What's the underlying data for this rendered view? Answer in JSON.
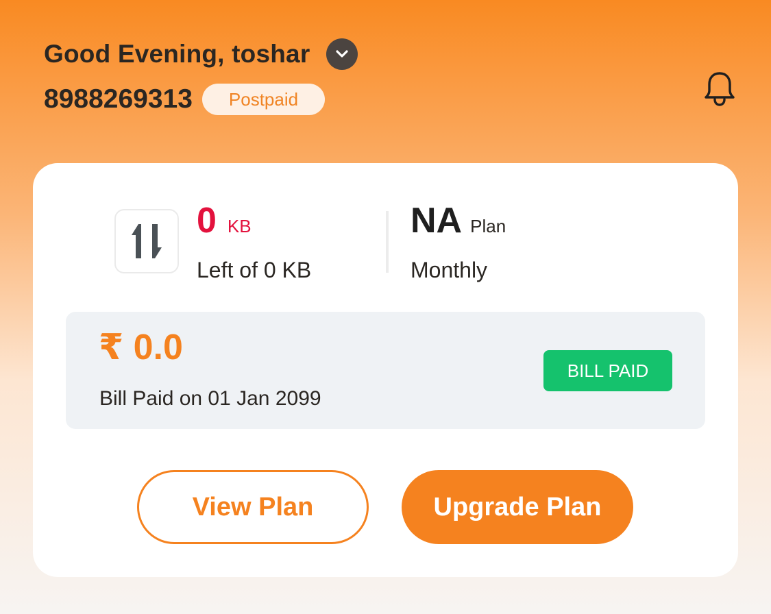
{
  "header": {
    "greeting": "Good Evening, toshar",
    "phone_number": "8988269313",
    "account_type_badge": "Postpaid",
    "icons": {
      "account_toggle": "chevron-down-icon",
      "notifications": "bell-icon"
    }
  },
  "usage_card": {
    "data": {
      "icon": "up-down-arrows-icon",
      "value": "0",
      "unit": "KB",
      "subtitle": "Left of 0 KB"
    },
    "plan": {
      "value": "NA",
      "unit": "Plan",
      "subtitle": "Monthly"
    },
    "bill": {
      "amount": "₹ 0.0",
      "date_text": "Bill Paid on 01 Jan 2099",
      "status": "BILL PAID"
    },
    "buttons": {
      "view_plan": "View Plan",
      "upgrade_plan": "Upgrade Plan"
    }
  },
  "colors": {
    "brand_orange": "#f5821f",
    "data_red": "#e3123d",
    "status_green": "#15c26d"
  }
}
